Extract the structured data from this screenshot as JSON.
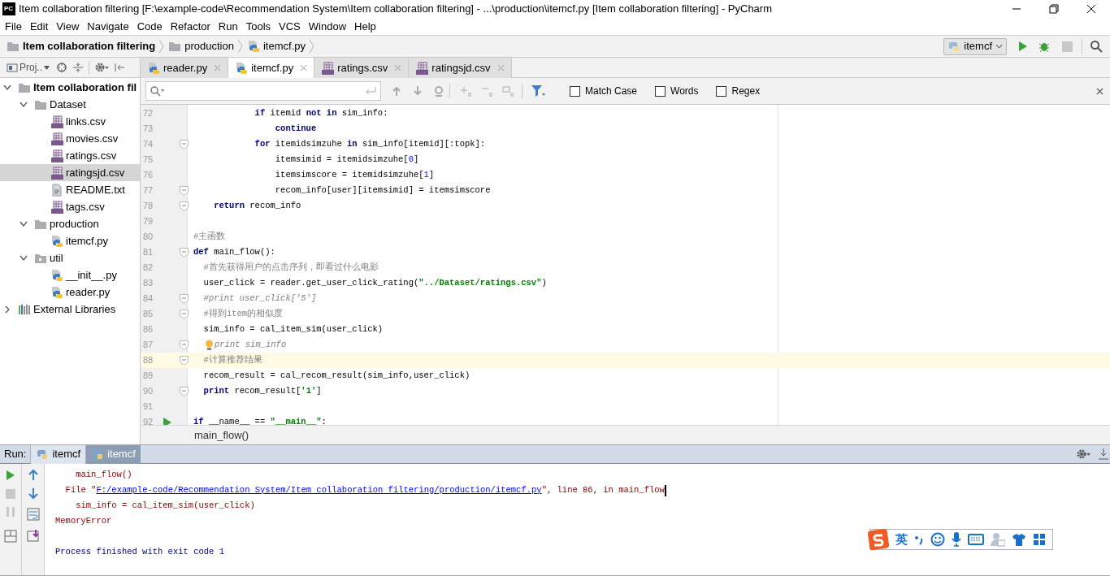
{
  "window": {
    "logo": "PC",
    "title": "Item collaboration filtering [F:\\example-code\\Recommendation System\\Item collaboration filtering] - ...\\production\\itemcf.py [Item collaboration filtering] - PyCharm"
  },
  "menu": [
    "File",
    "Edit",
    "View",
    "Navigate",
    "Code",
    "Refactor",
    "Run",
    "Tools",
    "VCS",
    "Window",
    "Help"
  ],
  "breadcrumb": [
    {
      "label": "Item collaboration filtering",
      "kind": "folder"
    },
    {
      "label": "production",
      "kind": "folder"
    },
    {
      "label": "itemcf.py",
      "kind": "py"
    }
  ],
  "run_config": {
    "label": "itemcf"
  },
  "project_toolbar": {
    "label": "Proj.."
  },
  "tabs": [
    {
      "label": "reader.py",
      "kind": "py",
      "selected": false
    },
    {
      "label": "itemcf.py",
      "kind": "py",
      "selected": true
    },
    {
      "label": "ratings.csv",
      "kind": "csv",
      "selected": false
    },
    {
      "label": "ratingsjd.csv",
      "kind": "csv",
      "selected": false
    }
  ],
  "tree": [
    {
      "label": "Item collaboration fil",
      "kind": "folder",
      "expanded": true,
      "selected": false,
      "children": [
        {
          "label": "Dataset",
          "kind": "folder",
          "expanded": true,
          "selected": false,
          "children": [
            {
              "label": "links.csv",
              "kind": "csv",
              "selected": false
            },
            {
              "label": "movies.csv",
              "kind": "csv",
              "selected": false
            },
            {
              "label": "ratings.csv",
              "kind": "csv",
              "selected": false
            },
            {
              "label": "ratingsjd.csv",
              "kind": "csv",
              "selected": true
            },
            {
              "label": "README.txt",
              "kind": "txt",
              "selected": false
            },
            {
              "label": "tags.csv",
              "kind": "csv",
              "selected": false
            }
          ]
        },
        {
          "label": "production",
          "kind": "folder",
          "expanded": true,
          "selected": false,
          "children": [
            {
              "label": "itemcf.py",
              "kind": "py",
              "selected": false
            }
          ]
        },
        {
          "label": "util",
          "kind": "package",
          "expanded": true,
          "selected": false,
          "children": [
            {
              "label": "__init__.py",
              "kind": "py",
              "selected": false
            },
            {
              "label": "reader.py",
              "kind": "py",
              "selected": false
            }
          ]
        }
      ]
    },
    {
      "label": "External Libraries",
      "kind": "library",
      "expanded": false,
      "selected": false
    }
  ],
  "find_bar": {
    "options": [
      {
        "label": "Match Case",
        "checked": false
      },
      {
        "label": "Words",
        "checked": false
      },
      {
        "label": "Regex",
        "checked": false
      }
    ]
  },
  "code": [
    {
      "number": "72",
      "fold": false,
      "tokens": [
        {
          "kind": "kw",
          "text": "            if"
        },
        {
          "kind": "plain",
          "text": " itemid "
        },
        {
          "kind": "kw",
          "text": "not in"
        },
        {
          "kind": "plain",
          "text": " sim_info:"
        }
      ]
    },
    {
      "number": "73",
      "fold": false,
      "tokens": [
        {
          "kind": "kw",
          "text": "                continue"
        }
      ]
    },
    {
      "number": "74",
      "fold": true,
      "tokens": [
        {
          "kind": "kw",
          "text": "            for"
        },
        {
          "kind": "plain",
          "text": " itemidsimzuhe "
        },
        {
          "kind": "kw",
          "text": "in"
        },
        {
          "kind": "plain",
          "text": " sim_info[itemid][:topk]:"
        }
      ]
    },
    {
      "number": "75",
      "fold": false,
      "tokens": [
        {
          "kind": "plain",
          "text": "                itemsimid = itemidsimzuhe["
        },
        {
          "kind": "num",
          "text": "0"
        },
        {
          "kind": "plain",
          "text": "]"
        }
      ]
    },
    {
      "number": "76",
      "fold": false,
      "tokens": [
        {
          "kind": "plain",
          "text": "                itemsimscore = itemidsimzuhe["
        },
        {
          "kind": "num",
          "text": "1"
        },
        {
          "kind": "plain",
          "text": "]"
        }
      ]
    },
    {
      "number": "77",
      "fold": true,
      "tokens": [
        {
          "kind": "plain",
          "text": "                recom_info[user][itemsimid] = itemsimscore"
        }
      ]
    },
    {
      "number": "78",
      "fold": true,
      "tokens": [
        {
          "kind": "kw",
          "text": "    return"
        },
        {
          "kind": "plain",
          "text": " recom_info"
        }
      ]
    },
    {
      "number": "79",
      "fold": false
    },
    {
      "number": "80",
      "fold": false,
      "tokens": [
        {
          "kind": "cmt",
          "text": "#主函数"
        }
      ]
    },
    {
      "number": "81",
      "fold": true,
      "tokens": [
        {
          "kind": "kw",
          "text": "def"
        },
        {
          "kind": "plain",
          "text": " main_flow():"
        }
      ]
    },
    {
      "number": "82",
      "fold": false,
      "tokens": [
        {
          "kind": "cmt",
          "text": "  #首先获得用户的点击序列，即看过什么电影"
        }
      ]
    },
    {
      "number": "83",
      "fold": false,
      "tokens": [
        {
          "kind": "plain",
          "text": "  user_click = reader.get_user_click_rating("
        },
        {
          "kind": "str",
          "text": "\"../Dataset/ratings.csv\""
        },
        {
          "kind": "plain",
          "text": ")"
        }
      ]
    },
    {
      "number": "84",
      "fold": true,
      "tokens": [
        {
          "kind": "icmt",
          "text": "  #print user_click['5']"
        }
      ]
    },
    {
      "number": "85",
      "fold": true,
      "tokens": [
        {
          "kind": "cmt",
          "text": "  #得到item的相似度"
        }
      ]
    },
    {
      "number": "86",
      "fold": false,
      "tokens": [
        {
          "kind": "plain",
          "text": "  sim_info = cal_item_sim(user_click)"
        }
      ]
    },
    {
      "number": "87",
      "fold": true,
      "bulb": true,
      "tokens": [
        {
          "kind": "icmt",
          "text": "print sim_info"
        }
      ]
    },
    {
      "number": "88",
      "fold": true,
      "current": true,
      "tokens": [
        {
          "kind": "cmt",
          "text": "  #计算推荐结果"
        }
      ]
    },
    {
      "number": "89",
      "fold": false,
      "tokens": [
        {
          "kind": "plain",
          "text": "  recom_result = cal_recom_result(sim_info,user_click)"
        }
      ]
    },
    {
      "number": "90",
      "fold": true,
      "tokens": [
        {
          "kind": "kw",
          "text": "  print"
        },
        {
          "kind": "plain",
          "text": " recom_result["
        },
        {
          "kind": "str",
          "text": "'1'"
        },
        {
          "kind": "plain",
          "text": "]"
        }
      ]
    },
    {
      "number": "91",
      "fold": false
    },
    {
      "number": "92",
      "fold": false,
      "run_marker": true,
      "tokens": [
        {
          "kind": "kw",
          "text": "if"
        },
        {
          "kind": "plain",
          "text": " __name__ == "
        },
        {
          "kind": "str",
          "text": "\"__main__\""
        },
        {
          "kind": "plain",
          "text": ":"
        }
      ]
    }
  ],
  "editor_breadcrumb": "main_flow()",
  "run_panel": {
    "label": "Run:",
    "tabs": [
      {
        "label": "itemcf",
        "selected": false
      },
      {
        "label": "itemcf",
        "selected": true
      }
    ],
    "console": [
      {
        "tokens": [
          {
            "kind": "err",
            "text": "    main_flow()"
          }
        ]
      },
      {
        "cursor": true,
        "tokens": [
          {
            "kind": "err",
            "text": "  File \""
          },
          {
            "kind": "link",
            "text": "F:/example-code/Recommendation System/Item collaboration filtering/production/itemcf.py"
          },
          {
            "kind": "err",
            "text": "\", line 86, in main_flow"
          }
        ]
      },
      {
        "tokens": [
          {
            "kind": "err",
            "text": "    sim_info = cal_item_sim(user_click)"
          }
        ]
      },
      {
        "tokens": [
          {
            "kind": "err",
            "text": "MemoryError"
          }
        ]
      },
      {
        "gap_before": true,
        "tokens": [
          {
            "kind": "info",
            "text": "Process finished with exit code 1"
          }
        ]
      }
    ]
  },
  "ime_bar": {
    "label": "英"
  }
}
